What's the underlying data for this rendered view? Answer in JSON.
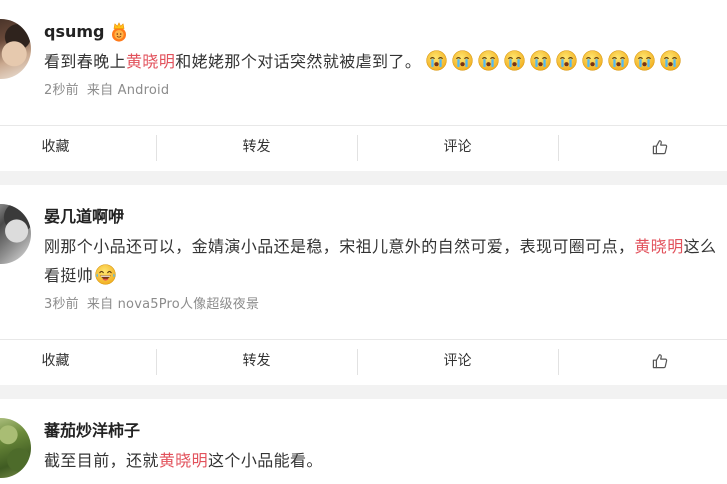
{
  "colors": {
    "mention": "#e2525c",
    "text": "#333333",
    "meta": "#8c8c8c",
    "separator_band": "#f2f2f2"
  },
  "actions": {
    "favorite_label": "收藏",
    "repost_label": "转发",
    "comment_label": "评论",
    "like_icon": "thumbs-up-icon"
  },
  "posts": [
    {
      "username": "qsumg",
      "badge_icon": "vip-crown-icon",
      "text_before": "看到春晚上",
      "mention": "黄晓明",
      "text_after": "和姥姥那个对话突然就被虐到了。",
      "emojis": [
        "cry-emoji",
        "cry-emoji",
        "cry-emoji",
        "cry-emoji",
        "cry-emoji",
        "cry-emoji",
        "cry-emoji",
        "cry-emoji",
        "cry-emoji",
        "cry-emoji"
      ],
      "time": "2秒前",
      "source": "来自 Android"
    },
    {
      "username": "晏几道啊咿",
      "text_before": "刚那个小品还可以，金婧演小品还是稳，宋祖儿意外的自然可爱，表现可圈可点，",
      "mention": "黄晓明",
      "text_after": "这么看挺帅",
      "emojis": [
        "laugh-cry-emoji"
      ],
      "time": "3秒前",
      "source": "来自 nova5Pro人像超级夜景"
    },
    {
      "username": "蕃茄炒洋柿子",
      "text_before": "截至目前，还就",
      "mention": "黄晓明",
      "text_after": "这个小品能看。"
    }
  ]
}
